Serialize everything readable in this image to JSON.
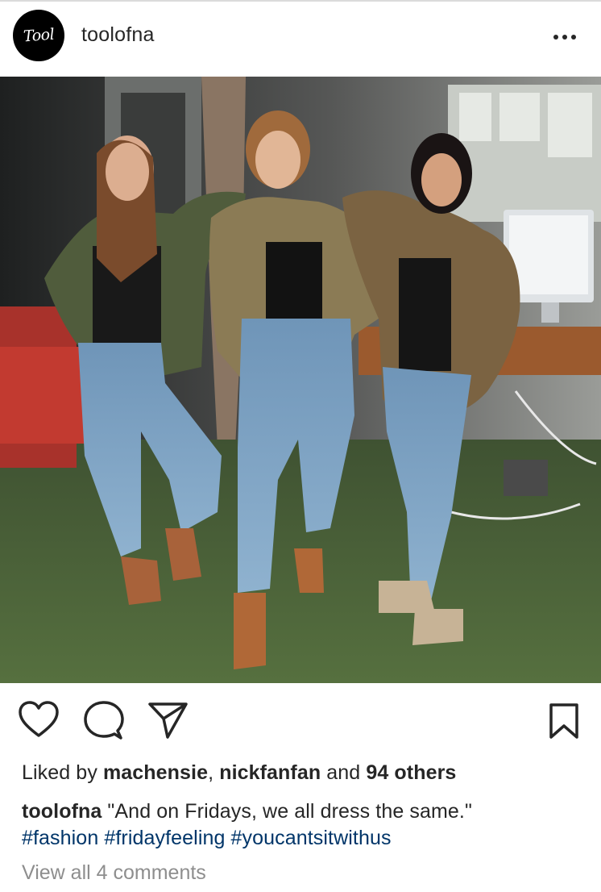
{
  "post": {
    "username": "toolofna",
    "avatar_text": "Tool",
    "more_icon": "more-horizontal-icon"
  },
  "actions": {
    "like_icon": "heart-icon",
    "comment_icon": "speech-bubble-icon",
    "share_icon": "paper-plane-icon",
    "save_icon": "bookmark-icon"
  },
  "likes": {
    "prefix": "Liked by",
    "user1": "machensie",
    "separator": ", ",
    "user2": "nickfanfan",
    "and_text": " and ",
    "others": "94 others"
  },
  "caption": {
    "username": "toolofna",
    "text": " \"And on Fridays, we all dress the same.\"",
    "hashtags": [
      "#fashion",
      "#fridayfeeling",
      "#youcantsitwithus"
    ]
  },
  "comments_link": "View all 4 comments",
  "colors": {
    "text": "#262626",
    "hashtag": "#003569",
    "muted": "#8e8e8e",
    "divider": "#dbdbdb"
  }
}
